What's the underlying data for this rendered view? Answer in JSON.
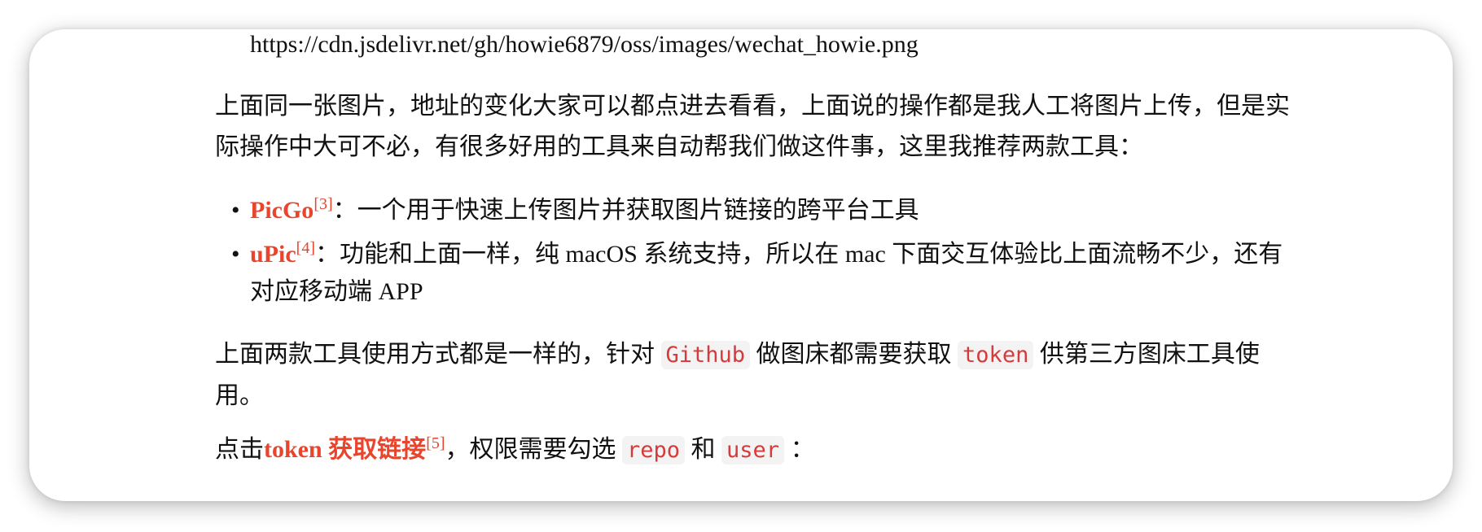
{
  "article": {
    "image_url": "https://cdn.jsdelivr.net/gh/howie6879/oss/images/wechat_howie.png",
    "para1": "上面同一张图片，地址的变化大家可以都点进去看看，上面说的操作都是我人工将图片上传，但是实际操作中大可不必，有很多好用的工具来自动帮我们做这件事，这里我推荐两款工具：",
    "tools": [
      {
        "name": "PicGo",
        "ref": "[3]",
        "desc": "：一个用于快速上传图片并获取图片链接的跨平台工具"
      },
      {
        "name": "uPic",
        "ref": "[4]",
        "desc": "：功能和上面一样，纯 macOS 系统支持，所以在 mac 下面交互体验比上面流畅不少，还有对应移动端 APP"
      }
    ],
    "para2": {
      "text_before": "上面两款工具使用方式都是一样的，针对",
      "code1": "Github",
      "text_mid": "做图床都需要获取",
      "code2": "token",
      "text_after": "供第三方图床工具使用。"
    },
    "para3": {
      "text_before": "点击",
      "link": "token 获取链接",
      "ref": "[5]",
      "text_mid": "，权限需要勾选",
      "code1": "repo",
      "text_and": "和",
      "code2": "user",
      "text_after": "："
    }
  }
}
